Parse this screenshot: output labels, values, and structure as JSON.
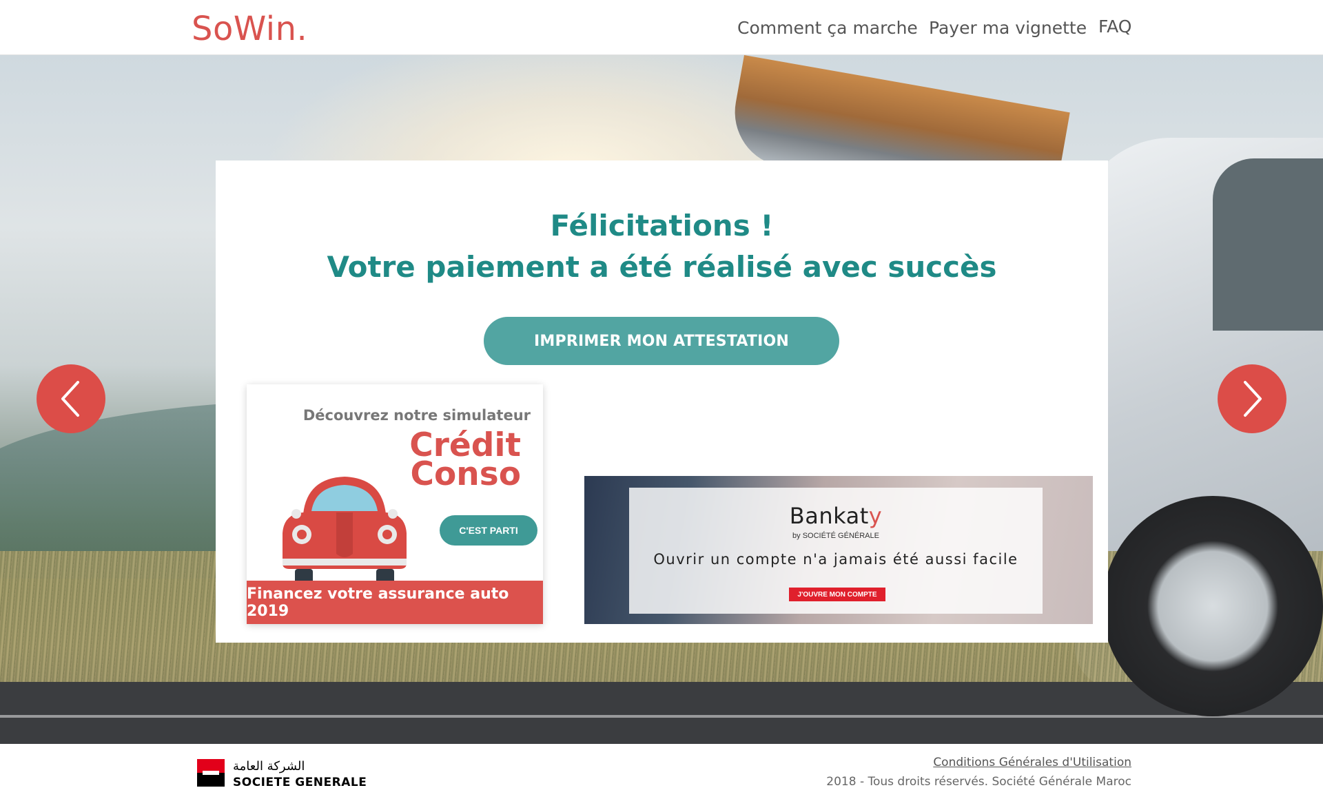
{
  "header": {
    "logo": "SoWin.",
    "nav": [
      "Comment ça marche",
      "Payer ma vignette",
      "FAQ"
    ]
  },
  "card": {
    "title_line1": "Félicitations !",
    "title_line2": "Votre paiement a été réalisé avec succès",
    "print_button": "IMPRIMER MON ATTESTATION"
  },
  "ad_credit": {
    "subtitle": "Découvrez notre simulateur",
    "line1": "Crédit",
    "line2": "Conso",
    "button": "C'EST PARTI",
    "footer": "Financez votre assurance auto 2019"
  },
  "ad_bankaty": {
    "brand_main": "Bankat",
    "brand_y": "y",
    "brand_sub": "by SOCIÉTÉ GÉNÉRALE",
    "text": "Ouvrir un compte n'a jamais été aussi facile",
    "button": "J'OUVRE MON COMPTE"
  },
  "footer": {
    "arabic_name": "الشركة العامة",
    "bank_name": "SOCIETE GENERALE",
    "cgu_link": "Conditions Générales d'Utilisation",
    "copyright": "2018 - Tous droits réservés. Société Générale Maroc"
  },
  "colors": {
    "brand_red": "#d9534f",
    "teal_title": "#1f8a86",
    "teal_button": "#52a5a2"
  },
  "icons": {
    "prev": "chevron-left-icon",
    "next": "chevron-right-icon"
  }
}
